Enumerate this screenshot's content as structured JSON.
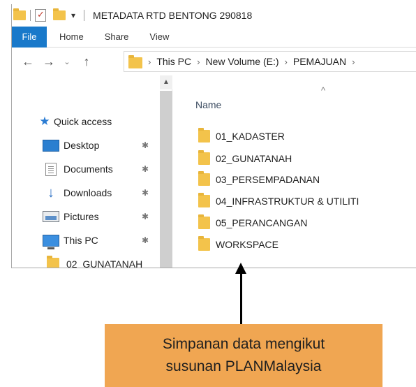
{
  "window": {
    "title": "METADATA RTD BENTONG 290818",
    "quick_access_toolbar": [
      "folder-icon",
      "properties-icon",
      "new-folder-icon",
      "customize-down-icon"
    ]
  },
  "ribbon": {
    "tabs": [
      {
        "label": "File",
        "active": true
      },
      {
        "label": "Home"
      },
      {
        "label": "Share"
      },
      {
        "label": "View"
      }
    ],
    "accent": "#1979ca"
  },
  "navigation": {
    "back_icon": "back-arrow-icon",
    "forward_icon": "forward-arrow-icon",
    "recent_icon": "chevron-down-icon",
    "up_icon": "up-arrow-icon",
    "breadcrumb": [
      "This PC",
      "New Volume (E:)",
      "PEMAJUAN"
    ]
  },
  "nav_pane": {
    "quick_access": "Quick access",
    "items": [
      {
        "label": "Desktop",
        "icon": "desktop-icon",
        "pinned": true
      },
      {
        "label": "Documents",
        "icon": "documents-icon",
        "pinned": true
      },
      {
        "label": "Downloads",
        "icon": "download-icon",
        "pinned": true
      },
      {
        "label": "Pictures",
        "icon": "pictures-icon",
        "pinned": true
      },
      {
        "label": "This PC",
        "icon": "this-pc-icon",
        "pinned": true
      },
      {
        "label": "02_GUNATANAH",
        "icon": "folder-icon",
        "pinned": false
      }
    ]
  },
  "content": {
    "column_header": "Name",
    "folders": [
      "01_KADASTER",
      "02_GUNATANAH",
      "03_PERSEMPADANAN",
      "04_INFRASTRUKTUR & UTILITI",
      "05_PERANCANGAN",
      "WORKSPACE"
    ]
  },
  "annotation": {
    "caption_line1": "Simpanan data mengikut",
    "caption_line2": "susunan PLANMalaysia",
    "box_color": "#f0a652"
  }
}
